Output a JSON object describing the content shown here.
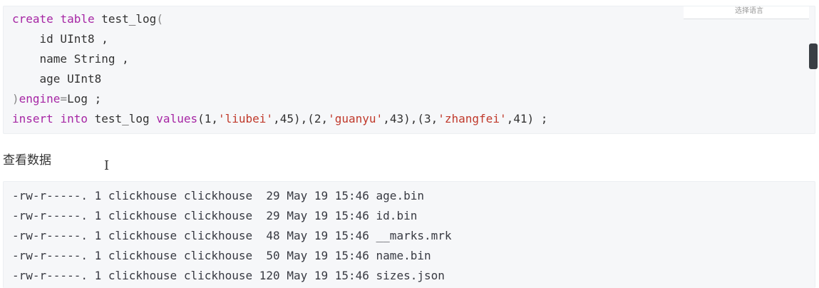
{
  "sql_code": {
    "lines": [
      [
        {
          "t": "kw",
          "v": "create"
        },
        {
          "t": "plain",
          "v": " "
        },
        {
          "t": "kw",
          "v": "table"
        },
        {
          "t": "plain",
          "v": " test_log"
        },
        {
          "t": "punc",
          "v": "("
        }
      ],
      [
        {
          "t": "plain",
          "v": "    id UInt8 ,"
        }
      ],
      [
        {
          "t": "plain",
          "v": "    name String ,"
        }
      ],
      [
        {
          "t": "plain",
          "v": "    age UInt8"
        }
      ],
      [
        {
          "t": "punc",
          "v": ")"
        },
        {
          "t": "kw",
          "v": "engine"
        },
        {
          "t": "punc",
          "v": "="
        },
        {
          "t": "plain",
          "v": "Log ;"
        }
      ],
      [
        {
          "t": "kw",
          "v": "insert"
        },
        {
          "t": "plain",
          "v": " "
        },
        {
          "t": "kw",
          "v": "into"
        },
        {
          "t": "plain",
          "v": " test_log "
        },
        {
          "t": "kw",
          "v": "values"
        },
        {
          "t": "plain",
          "v": "(1,"
        },
        {
          "t": "str",
          "v": "'liubei'"
        },
        {
          "t": "plain",
          "v": ",45),(2,"
        },
        {
          "t": "str",
          "v": "'guanyu'"
        },
        {
          "t": "plain",
          "v": ",43),(3,"
        },
        {
          "t": "str",
          "v": "'zhangfei'"
        },
        {
          "t": "plain",
          "v": ",41) ;"
        }
      ]
    ]
  },
  "language_select": {
    "label": "选择语言"
  },
  "section_heading": "查看数据",
  "file_listing": {
    "rows": [
      "-rw-r-----. 1 clickhouse clickhouse  29 May 19 15:46 age.bin",
      "-rw-r-----. 1 clickhouse clickhouse  29 May 19 15:46 id.bin",
      "-rw-r-----. 1 clickhouse clickhouse  48 May 19 15:46 __marks.mrk",
      "-rw-r-----. 1 clickhouse clickhouse  50 May 19 15:46 name.bin",
      "-rw-r-----. 1 clickhouse clickhouse 120 May 19 15:46 sizes.json"
    ]
  },
  "cursor_icon": "text-cursor-icon",
  "colors": {
    "keyword": "#a626a4",
    "string": "#c0392b",
    "code_bg": "#f6f7f9"
  }
}
